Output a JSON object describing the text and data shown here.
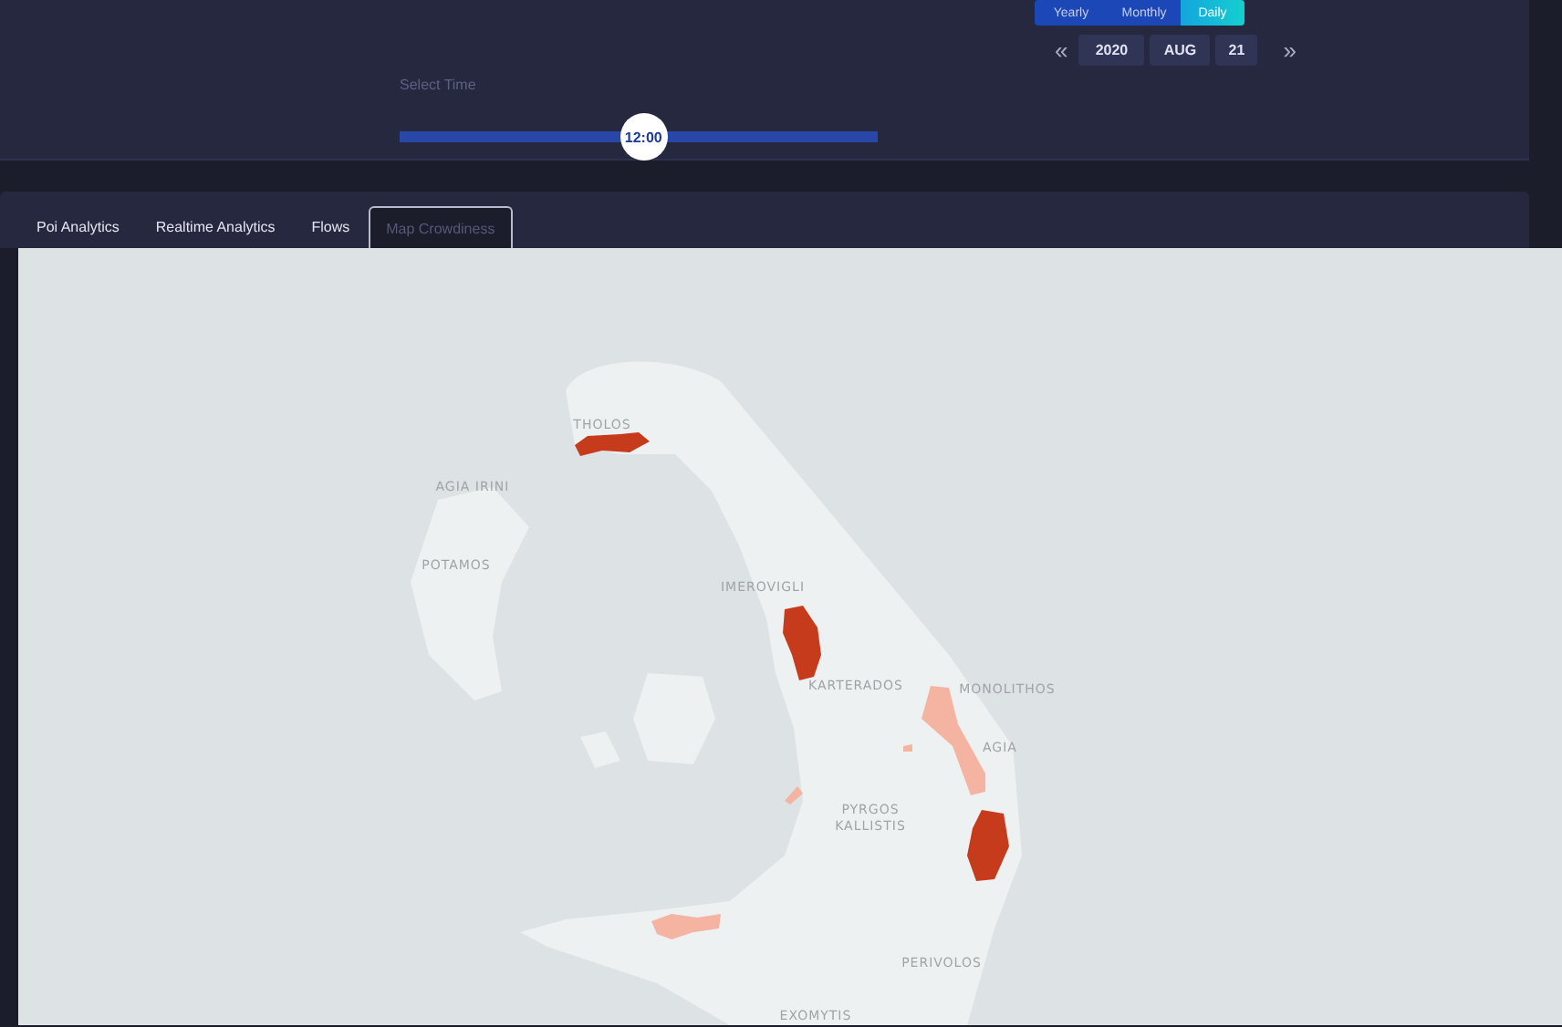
{
  "periods": [
    {
      "label": "Yearly",
      "selected": false
    },
    {
      "label": "Monthly",
      "selected": false
    },
    {
      "label": "Daily",
      "selected": true
    }
  ],
  "date": {
    "prev": "«",
    "year": "2020",
    "month": "AUG",
    "day": "21",
    "next": "»"
  },
  "time_slider": {
    "label": "Select Time",
    "level": 0.51,
    "value": "12:00"
  },
  "tabs": [
    {
      "label": "Poi Analytics",
      "selected": false
    },
    {
      "label": "Realtime Analytics",
      "selected": false
    },
    {
      "label": "Flows",
      "selected": false
    },
    {
      "label": "Map Crowdiness",
      "selected": true
    }
  ],
  "map": {
    "labels": [
      "THOLOS",
      "AGIA IRINI",
      "POTAMOS",
      "IMEROVIGLI",
      "KARTERADOS",
      "MONOLITHOS",
      "AGIA",
      "PYRGOS",
      "KALLISTIS",
      "PERIVOLOS",
      "EXOMYTIS"
    ],
    "areas": [
      {
        "color": "#c63b1c"
      },
      {
        "color": "#c63b1c"
      },
      {
        "color": "#c63b1c"
      },
      {
        "color": "#f5b4a2"
      },
      {
        "color": "#f5b4a2"
      },
      {
        "color": "#f5b4a2"
      },
      {
        "color": "#f5b4a2"
      }
    ]
  }
}
